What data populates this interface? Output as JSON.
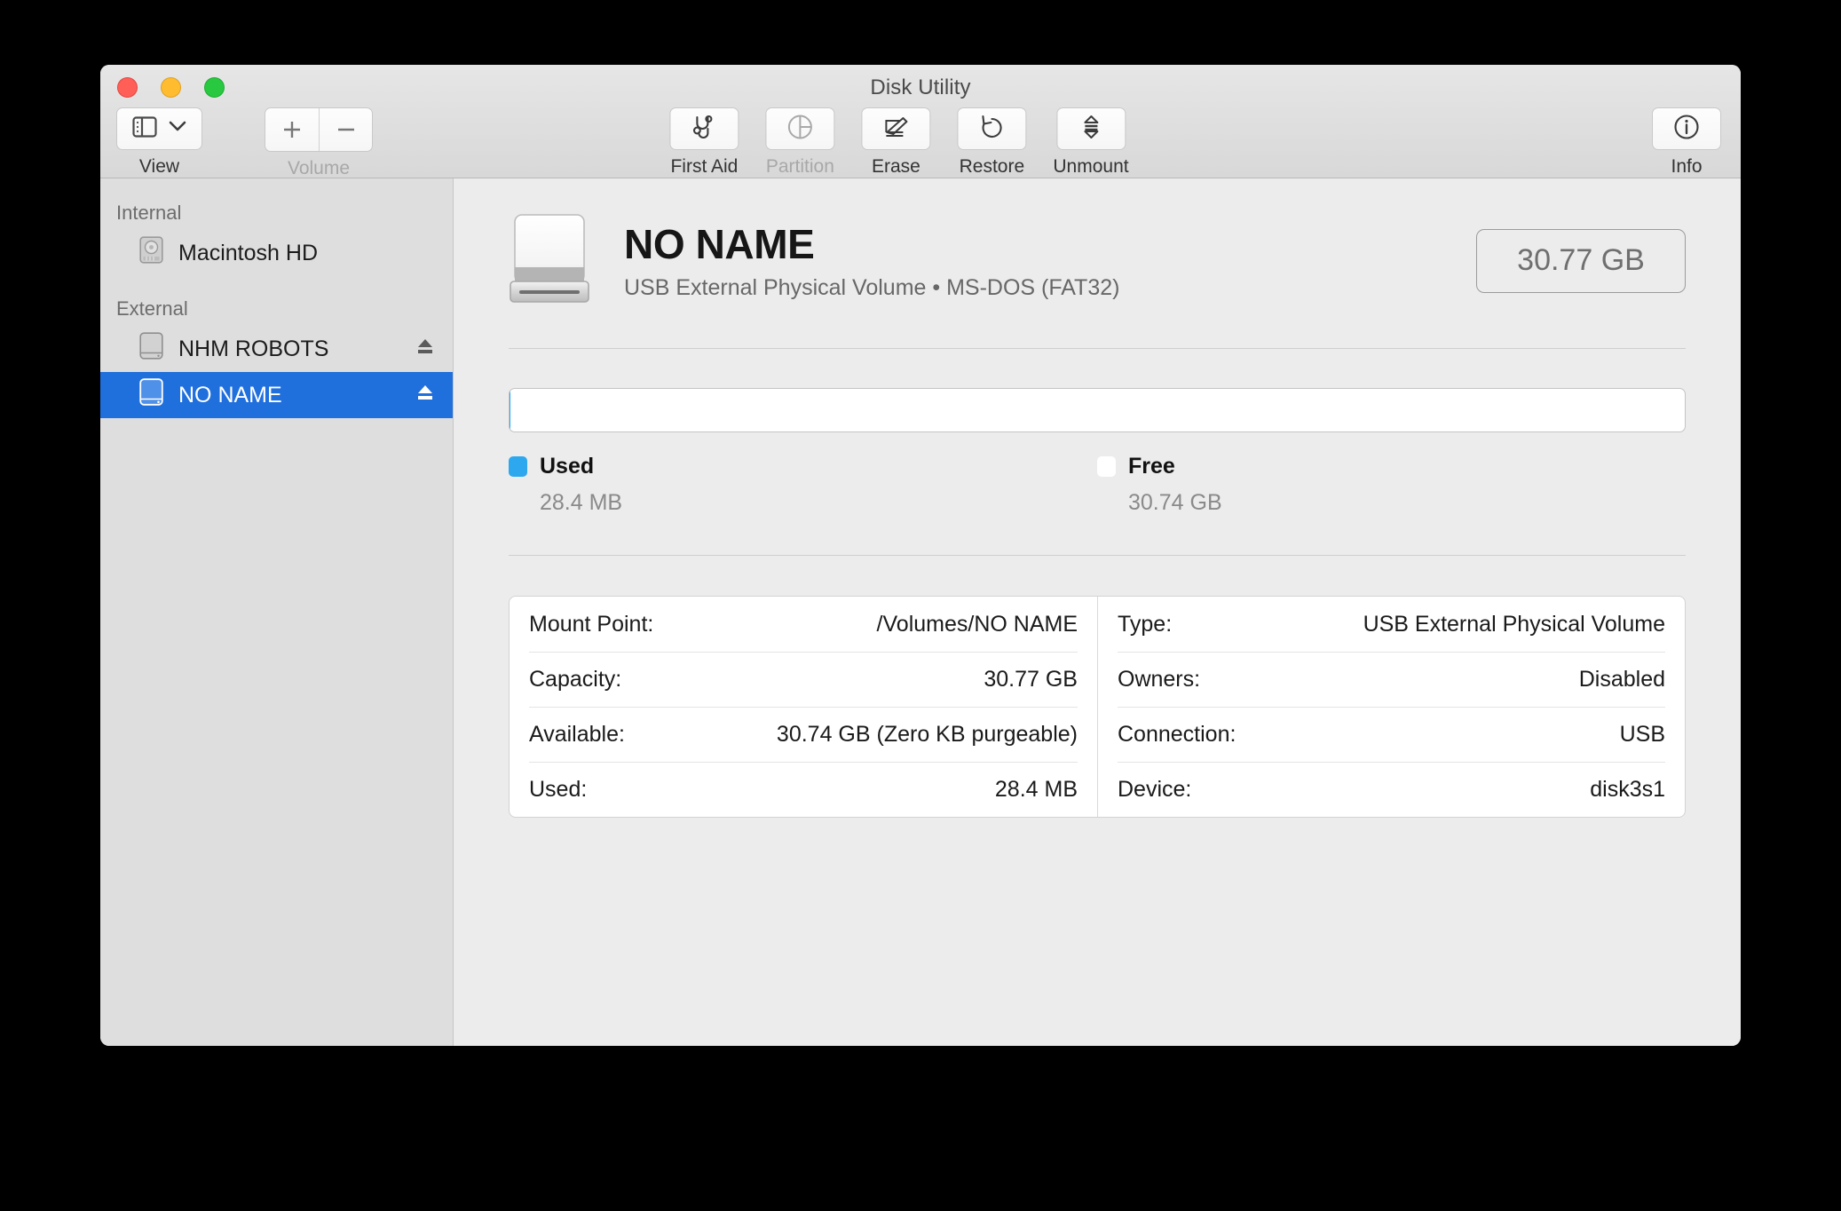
{
  "window": {
    "title": "Disk Utility",
    "traffic_lights": [
      "close",
      "minimize",
      "zoom"
    ]
  },
  "toolbar": {
    "view": {
      "label": "View",
      "icon": "sidebar-icon",
      "chevron": "chevron-down-icon",
      "disabled": false
    },
    "volume": {
      "label": "Volume",
      "add": "+",
      "remove": "−",
      "disabled": true
    },
    "actions": [
      {
        "label": "First Aid",
        "icon": "stethoscope-icon",
        "disabled": false
      },
      {
        "label": "Partition",
        "icon": "pie-chart-icon",
        "disabled": true
      },
      {
        "label": "Erase",
        "icon": "erase-pencil-icon",
        "disabled": false
      },
      {
        "label": "Restore",
        "icon": "undo-arrow-icon",
        "disabled": false
      },
      {
        "label": "Unmount",
        "icon": "eject-stack-icon",
        "disabled": false
      }
    ],
    "info": {
      "label": "Info",
      "icon": "info-circle-icon"
    }
  },
  "sidebar": {
    "groups": [
      {
        "header": "Internal",
        "items": [
          {
            "name": "Macintosh HD",
            "icon": "internal-disk-icon",
            "selected": false,
            "eject": false
          }
        ]
      },
      {
        "header": "External",
        "items": [
          {
            "name": "NHM ROBOTS",
            "icon": "external-drive-icon",
            "selected": false,
            "eject": true
          },
          {
            "name": "NO NAME",
            "icon": "external-drive-icon",
            "selected": true,
            "eject": true
          }
        ]
      }
    ]
  },
  "volume": {
    "icon": "external-drive-large-icon",
    "name": "NO NAME",
    "subtitle": "USB External Physical Volume • MS-DOS (FAT32)",
    "capacity_badge": "30.77 GB"
  },
  "usage": {
    "used_percent": 0.09,
    "free_percent": 99.91,
    "legend": [
      {
        "name": "Used",
        "value": "28.4 MB",
        "swatch": "used"
      },
      {
        "name": "Free",
        "value": "30.74 GB",
        "swatch": "free"
      }
    ]
  },
  "details": {
    "left": [
      {
        "label": "Mount Point:",
        "value": "/Volumes/NO NAME"
      },
      {
        "label": "Capacity:",
        "value": "30.77 GB"
      },
      {
        "label": "Available:",
        "value": "30.74 GB (Zero KB purgeable)"
      },
      {
        "label": "Used:",
        "value": "28.4 MB"
      }
    ],
    "right": [
      {
        "label": "Type:",
        "value": "USB External Physical Volume"
      },
      {
        "label": "Owners:",
        "value": "Disabled"
      },
      {
        "label": "Connection:",
        "value": "USB"
      },
      {
        "label": "Device:",
        "value": "disk3s1"
      }
    ]
  },
  "colors": {
    "selection_blue": "#1f6fdd",
    "used_blue": "#2da8ee",
    "sidebar_bg": "#dedede",
    "main_bg": "#ececec"
  }
}
